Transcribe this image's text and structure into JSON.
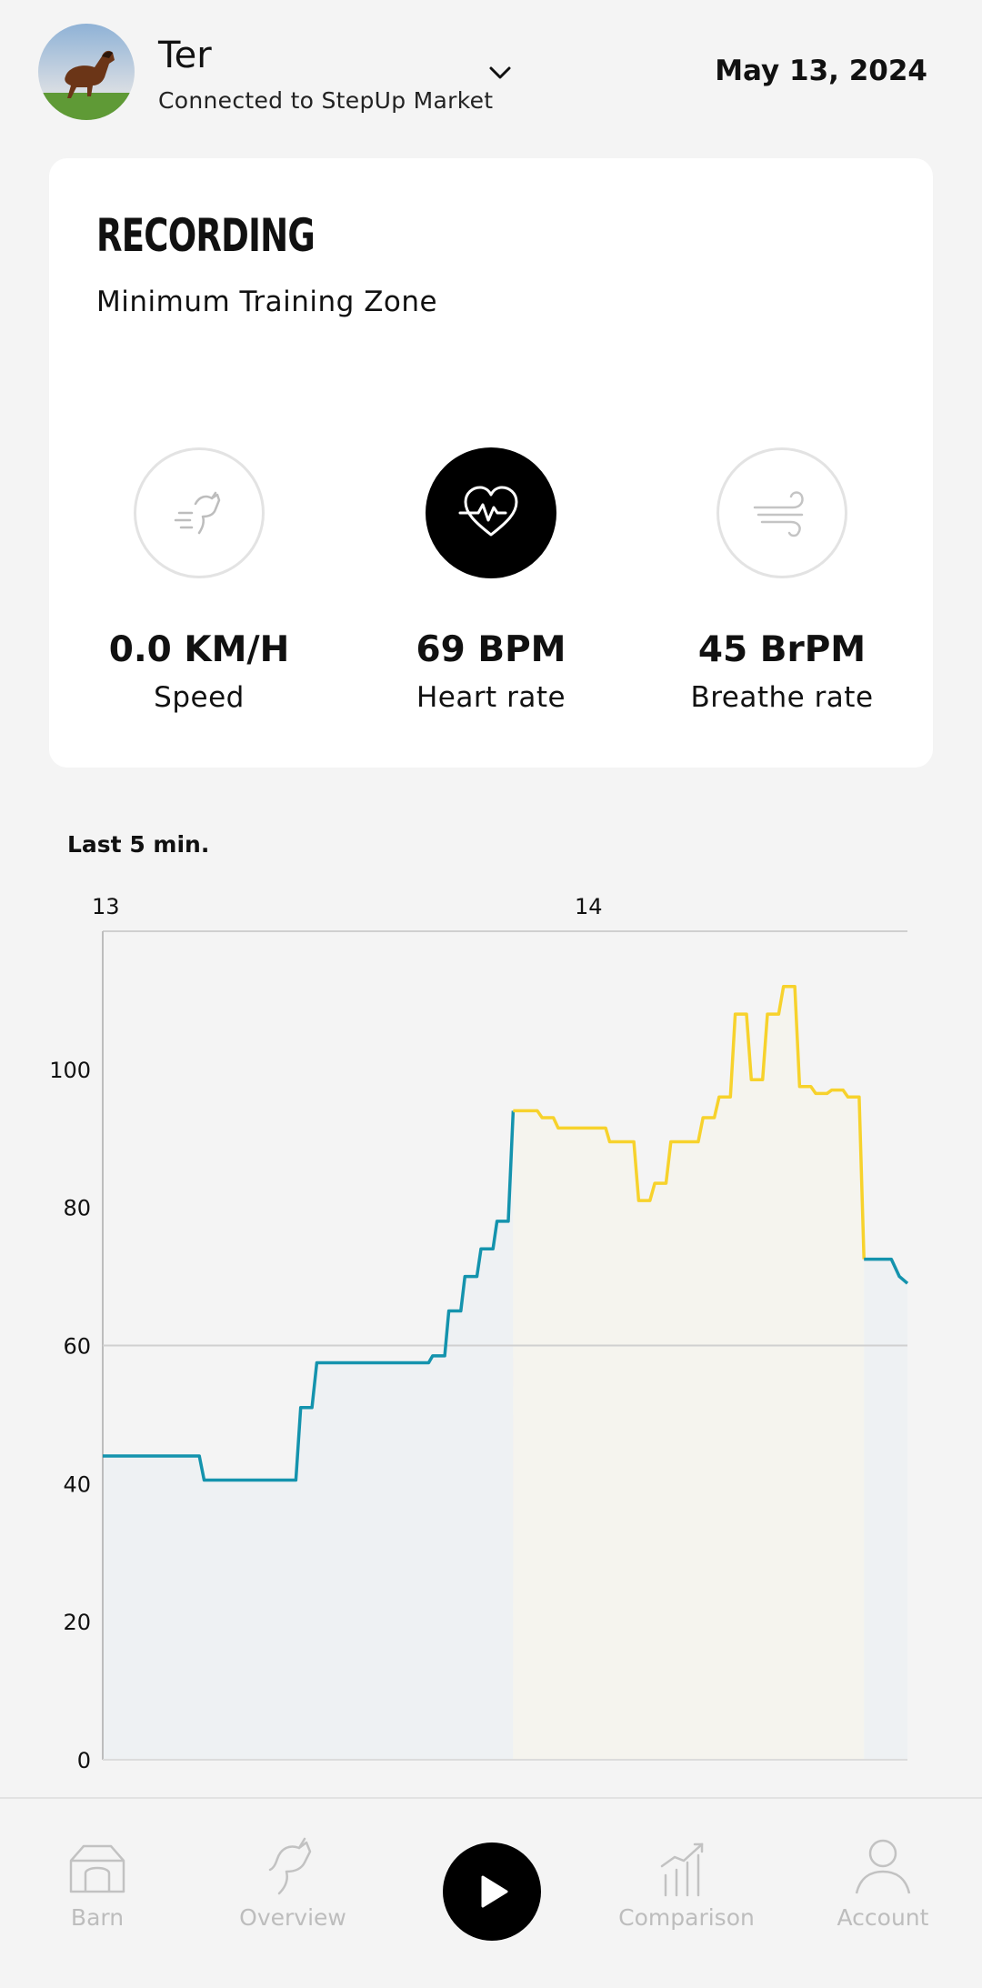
{
  "header": {
    "horse_name": "Ter",
    "connection": "Connected to StepUp Market",
    "date": "May 13, 2024"
  },
  "recording": {
    "title": "RECORDING",
    "subtitle": "Minimum Training Zone",
    "metrics": [
      {
        "value": "0.0 KM/H",
        "label": "Speed",
        "icon": "horse-speed-icon",
        "active": false
      },
      {
        "value": "69 BPM",
        "label": "Heart rate",
        "icon": "heart-pulse-icon",
        "active": true
      },
      {
        "value": "45 BrPM",
        "label": "Breathe rate",
        "icon": "wind-icon",
        "active": false
      }
    ]
  },
  "chart_caption": "Last 5 min.",
  "chart_data": {
    "type": "line",
    "title": "",
    "xlabel": "",
    "ylabel": "",
    "x_ticks": [
      {
        "label": "13",
        "x": 0
      },
      {
        "label": "14",
        "x": 60
      }
    ],
    "xlim": [
      0,
      100
    ],
    "ylim": [
      0,
      120
    ],
    "y_ticks": [
      0,
      20,
      40,
      60,
      80,
      100
    ],
    "reference_line": 60,
    "colors": {
      "below_zone": "#1493ad",
      "in_zone": "#f7d22c",
      "fill_below": "#eef1f3",
      "fill_in_zone": "#f5f4ee"
    },
    "series": [
      {
        "values": [
          [
            0,
            44
          ],
          [
            12,
            44
          ],
          [
            12.6,
            40.5
          ],
          [
            24,
            40.5
          ],
          [
            24.6,
            51
          ],
          [
            26,
            51
          ],
          [
            26.6,
            57.5
          ],
          [
            40.5,
            57.5
          ],
          [
            41,
            58.5
          ],
          [
            42.5,
            58.5
          ],
          [
            43,
            65
          ],
          [
            44.5,
            65
          ],
          [
            45,
            70
          ],
          [
            46.5,
            70
          ],
          [
            47,
            74
          ],
          [
            48.5,
            74
          ],
          [
            49,
            78
          ],
          [
            50.4,
            78
          ],
          [
            51,
            94
          ],
          [
            54,
            94
          ],
          [
            54.6,
            93
          ],
          [
            56,
            93
          ],
          [
            56.6,
            91.5
          ],
          [
            62.5,
            91.5
          ],
          [
            63,
            89.5
          ],
          [
            66,
            89.5
          ],
          [
            66.6,
            81
          ],
          [
            68,
            81
          ],
          [
            68.6,
            83.5
          ],
          [
            70,
            83.5
          ],
          [
            70.6,
            89.5
          ],
          [
            74,
            89.5
          ],
          [
            74.6,
            93
          ],
          [
            76,
            93
          ],
          [
            76.6,
            96
          ],
          [
            78,
            96
          ],
          [
            78.6,
            108
          ],
          [
            80,
            108
          ],
          [
            80.6,
            98.5
          ],
          [
            82,
            98.5
          ],
          [
            82.6,
            108
          ],
          [
            84,
            108
          ],
          [
            84.6,
            112
          ],
          [
            86,
            112
          ],
          [
            86.6,
            97.5
          ],
          [
            88,
            97.5
          ],
          [
            88.6,
            96.5
          ],
          [
            90,
            96.5
          ],
          [
            90.6,
            97
          ],
          [
            92,
            97
          ],
          [
            92.6,
            96
          ],
          [
            94,
            96
          ],
          [
            94.6,
            72.5
          ],
          [
            98,
            72.5
          ],
          [
            99,
            70
          ],
          [
            100,
            69
          ]
        ]
      }
    ],
    "zone": {
      "from_x": 51,
      "to_x": 94.6
    }
  },
  "nav": {
    "items": [
      {
        "label": "Barn",
        "icon": "barn-icon"
      },
      {
        "label": "Overview",
        "icon": "horse-head-icon"
      },
      {
        "label": "",
        "icon": "play-icon"
      },
      {
        "label": "Comparison",
        "icon": "chart-growth-icon"
      },
      {
        "label": "Account",
        "icon": "user-icon"
      }
    ]
  }
}
